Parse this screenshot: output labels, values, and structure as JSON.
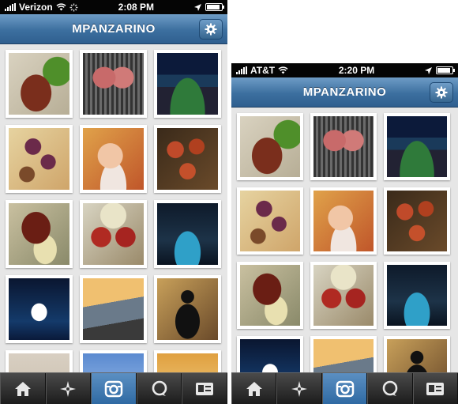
{
  "left": {
    "status": {
      "carrier": "Verizon",
      "time": "2:08 PM"
    },
    "header": {
      "title": "MPANZARINO"
    },
    "photos": [
      "steak",
      "grill",
      "stadium",
      "tacos",
      "baby",
      "salad",
      "meat",
      "pork",
      "stage",
      "amazon",
      "crowd",
      "batman",
      "sand",
      "sky",
      "dusk"
    ],
    "tabs": [
      "home-icon",
      "explore-icon",
      "camera-icon",
      "news-icon",
      "profile-icon"
    ],
    "active_tab": 2
  },
  "right": {
    "status": {
      "carrier": "AT&T",
      "time": "2:20 PM"
    },
    "header": {
      "title": "MPANZARINO"
    },
    "photos": [
      "steak",
      "grill",
      "stadium",
      "tacos",
      "baby",
      "salad",
      "meat",
      "pork",
      "stage",
      "amazon",
      "crowd",
      "batman"
    ],
    "tabs": [
      "home-icon",
      "explore-icon",
      "camera-icon",
      "news-icon",
      "profile-icon"
    ],
    "active_tab": 2
  },
  "colors": {
    "navbar": "#3c6f9f",
    "tab_active": "#3f78b1",
    "tabbar": "#2a2a2a"
  }
}
